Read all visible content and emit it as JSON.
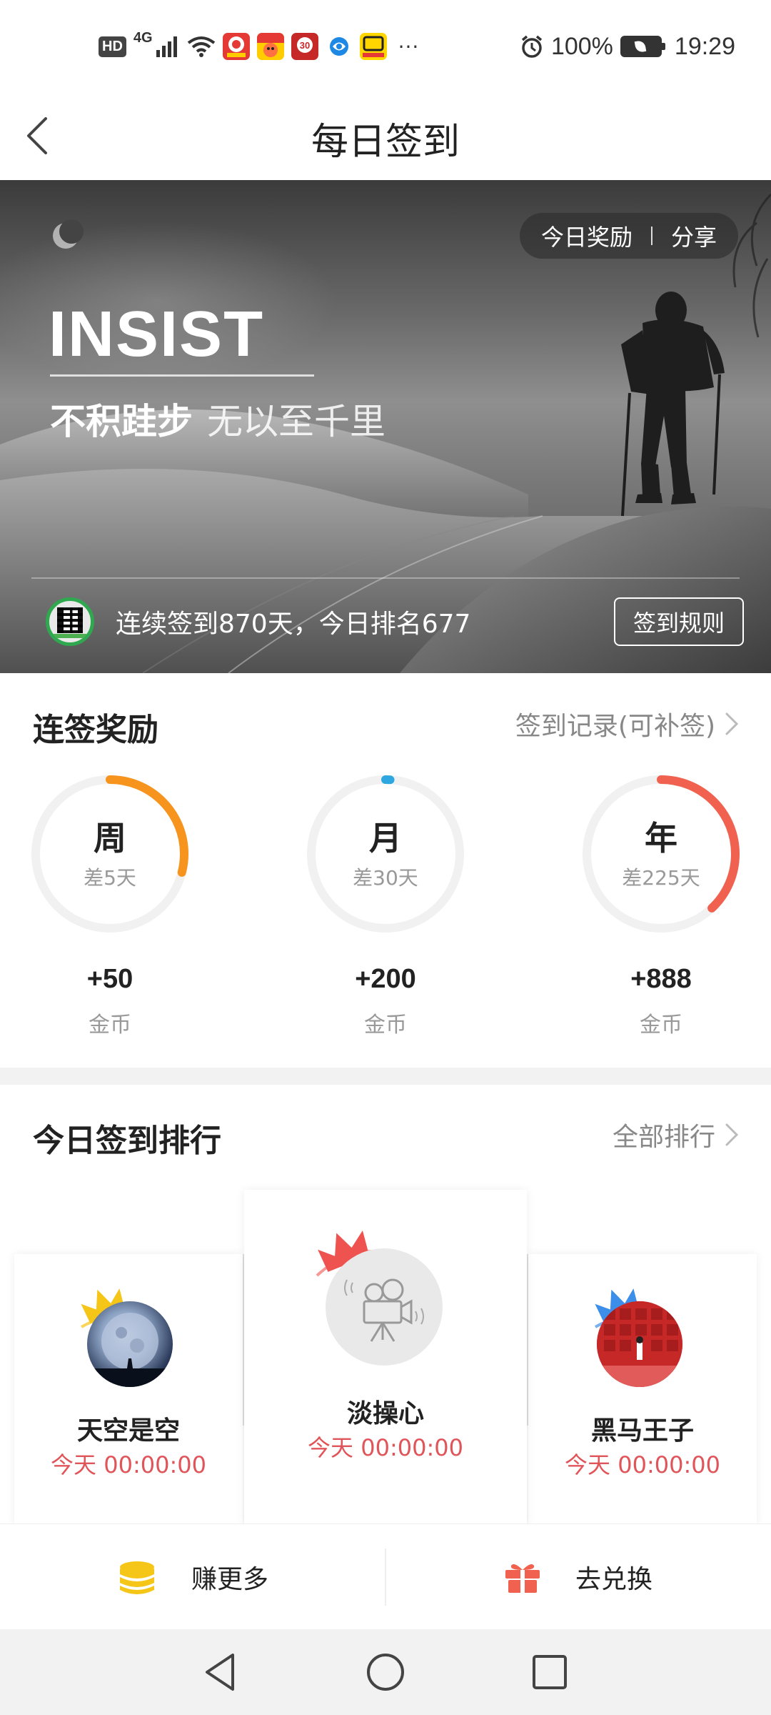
{
  "status_bar": {
    "network": "4G",
    "hd": "HD",
    "battery": "100%",
    "time": "19:29",
    "more": "···",
    "icons": [
      "hd-icon",
      "signal-icon",
      "wifi-icon",
      "app-notification-icons",
      "alarm-icon",
      "battery-icon"
    ]
  },
  "header": {
    "title": "每日签到",
    "back_icon": "chevron-left-icon"
  },
  "banner": {
    "reward_label": "今日奖励",
    "share_label": "分享",
    "headline": "INSIST",
    "motto_1": "不积跬步",
    "motto_2": "无以至千里",
    "streak_text": "连续签到870天，今日排名677",
    "rules_button": "签到规则"
  },
  "streak_rewards": {
    "title": "连签奖励",
    "record_link": "签到记录(可补签)",
    "items": [
      {
        "label": "周",
        "remaining": "差5天",
        "reward": "+50",
        "unit": "金币",
        "progress": 0.29,
        "color": "#f7941d"
      },
      {
        "label": "月",
        "remaining": "差30天",
        "reward": "+200",
        "unit": "金币",
        "progress": 0.01,
        "color": "#2ea7e0"
      },
      {
        "label": "年",
        "remaining": "差225天",
        "reward": "+888",
        "unit": "金币",
        "progress": 0.38,
        "color": "#f0614f"
      }
    ]
  },
  "ranking": {
    "title": "今日签到排行",
    "all_link": "全部排行",
    "entries": [
      {
        "name": "淡操心",
        "time": "今天 00:00:00",
        "crown_color": "#ef5350",
        "position": "first"
      },
      {
        "name": "天空是空",
        "time": "今天 00:00:00",
        "crown_color": "#f5c518",
        "position": "second"
      },
      {
        "name": "黑马王子",
        "time": "今天 00:00:00",
        "crown_color": "#3d8ee8",
        "position": "third"
      }
    ]
  },
  "actions": {
    "earn_more": "赚更多",
    "redeem": "去兑换"
  },
  "colors": {
    "accent_red": "#e0555a",
    "coin_yellow": "#f5c518",
    "gift_red": "#f0614f"
  }
}
